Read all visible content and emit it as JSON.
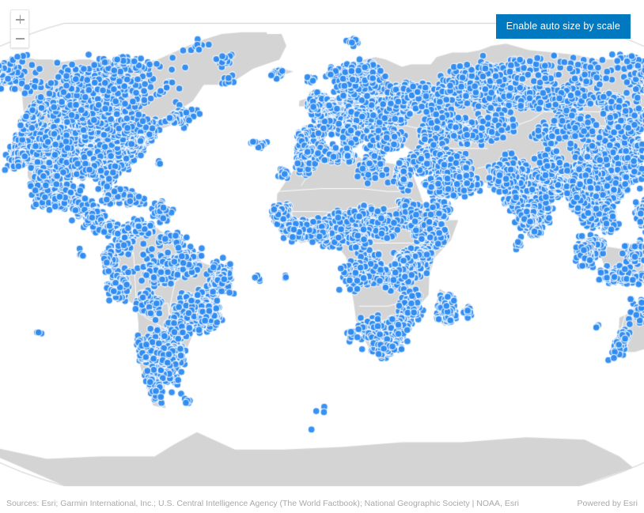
{
  "map": {
    "projection": "robinson",
    "basemap_land_color": "#d4d4d4",
    "basemap_border_color": "#ffffff",
    "basemap_ocean_color": "#ffffff",
    "graticule_color": "#cfcfcf",
    "point_fill_color": "#2e8bf0",
    "point_outline_color": "#ffffff",
    "point_radius_px": 4.4,
    "point_count_label": ""
  },
  "zoom_widget": {
    "zoom_in_label": "+",
    "zoom_in_icon": "plus-icon",
    "zoom_out_label": "−",
    "zoom_out_icon": "minus-icon"
  },
  "toolbar": {
    "auto_size_label": "Enable auto size by scale",
    "auto_size_bg": "#0079c1",
    "auto_size_fg": "#ffffff"
  },
  "attribution": {
    "sources": "Sources: Esri; Garmin International, Inc.; U.S. Central Intelligence Agency (The World Factbook); National Geographic Society | NOAA, Esri",
    "powered_by": "Powered by Esri"
  }
}
